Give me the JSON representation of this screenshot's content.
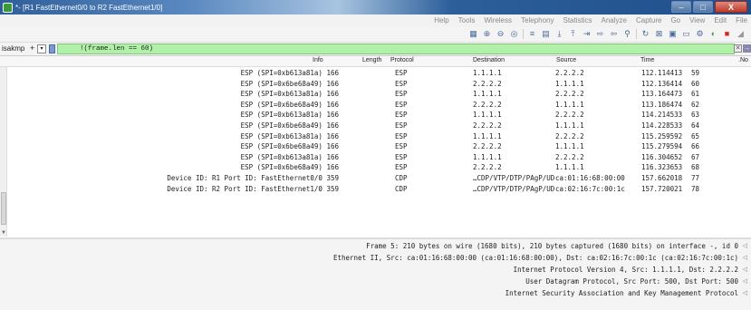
{
  "window": {
    "title": "*- [R1 FastEthernet0/0 to R2 FastEthernet1/0]",
    "minimize": "–",
    "maximize": "□",
    "close": "X"
  },
  "menu": [
    "File",
    "Edit",
    "View",
    "Go",
    "Capture",
    "Analyze",
    "Statistics",
    "Telephony",
    "Wireless",
    "Tools",
    "Help"
  ],
  "filter": {
    "label": "isakmp",
    "plus": "+",
    "value": "!(frame.len == 60)"
  },
  "columns": {
    "no": ".No",
    "time": "Time",
    "source": "Source",
    "destination": "Destination",
    "protocol": "Protocol",
    "length": "Length",
    "info": "Info"
  },
  "packets": [
    {
      "info": "ESP (SPI=0xb613a81a) 166",
      "proto": "ESP",
      "dst": "1.1.1.1",
      "src": "2.2.2.2",
      "time": "112.114413",
      "no": "59"
    },
    {
      "info": "ESP (SPI=0x6be68a49) 166",
      "proto": "ESP",
      "dst": "2.2.2.2",
      "src": "1.1.1.1",
      "time": "112.136414",
      "no": "60"
    },
    {
      "info": "ESP (SPI=0xb613a81a) 166",
      "proto": "ESP",
      "dst": "1.1.1.1",
      "src": "2.2.2.2",
      "time": "113.164473",
      "no": "61"
    },
    {
      "info": "ESP (SPI=0x6be68a49) 166",
      "proto": "ESP",
      "dst": "2.2.2.2",
      "src": "1.1.1.1",
      "time": "113.186474",
      "no": "62"
    },
    {
      "info": "ESP (SPI=0xb613a81a) 166",
      "proto": "ESP",
      "dst": "1.1.1.1",
      "src": "2.2.2.2",
      "time": "114.214533",
      "no": "63"
    },
    {
      "info": "ESP (SPI=0x6be68a49) 166",
      "proto": "ESP",
      "dst": "2.2.2.2",
      "src": "1.1.1.1",
      "time": "114.228533",
      "no": "64"
    },
    {
      "info": "ESP (SPI=0xb613a81a) 166",
      "proto": "ESP",
      "dst": "1.1.1.1",
      "src": "2.2.2.2",
      "time": "115.259592",
      "no": "65"
    },
    {
      "info": "ESP (SPI=0x6be68a49) 166",
      "proto": "ESP",
      "dst": "2.2.2.2",
      "src": "1.1.1.1",
      "time": "115.279594",
      "no": "66"
    },
    {
      "info": "ESP (SPI=0xb613a81a) 166",
      "proto": "ESP",
      "dst": "1.1.1.1",
      "src": "2.2.2.2",
      "time": "116.304652",
      "no": "67"
    },
    {
      "info": "ESP (SPI=0x6be68a49) 166",
      "proto": "ESP",
      "dst": "2.2.2.2",
      "src": "1.1.1.1",
      "time": "116.323653",
      "no": "68"
    },
    {
      "info": "Device ID: R1  Port ID: FastEthernet0/0 359",
      "proto": "CDP",
      "dst": "…CDP/VTP/DTP/PAgP/UD",
      "src": "ca:01:16:68:00:00",
      "time": "157.662018",
      "no": "77"
    },
    {
      "info": "Device ID: R2  Port ID: FastEthernet1/0 359",
      "proto": "CDP",
      "dst": "…CDP/VTP/DTP/PAgP/UD",
      "src": "ca:02:16:7c:00:1c",
      "time": "157.720021",
      "no": "78"
    }
  ],
  "details": [
    "Frame 5: 210 bytes on wire (1680 bits), 210 bytes captured (1680 bits) on interface -, id 0",
    "Ethernet II, Src: ca:01:16:68:00:00 (ca:01:16:68:00:00), Dst: ca:02:16:7c:00:1c (ca:02:16:7c:00:1c)",
    "Internet Protocol Version 4, Src: 1.1.1.1, Dst: 2.2.2.2",
    "User Datagram Protocol, Src Port: 500, Dst Port: 500",
    "Internet Security Association and Key Management Protocol"
  ],
  "colors": {
    "filter_bg": "#b0f0a8",
    "titlebar": "#2f5f9a"
  }
}
